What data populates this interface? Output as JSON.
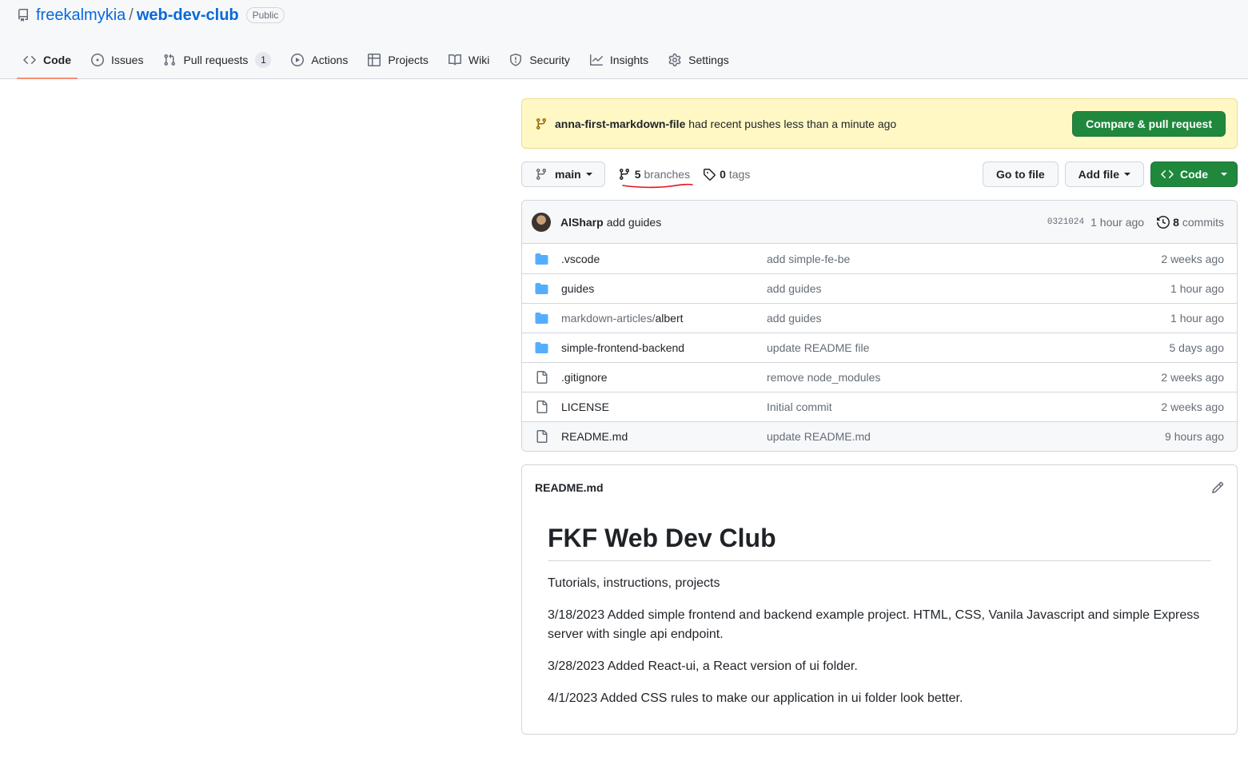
{
  "repo": {
    "owner": "freekalmykia",
    "separator": "/",
    "name": "web-dev-club",
    "visibility": "Public"
  },
  "tabs": [
    {
      "label": "Code",
      "icon": "code-icon",
      "active": true
    },
    {
      "label": "Issues",
      "icon": "issue-icon"
    },
    {
      "label": "Pull requests",
      "icon": "pull-request-icon",
      "count": "1"
    },
    {
      "label": "Actions",
      "icon": "play-icon"
    },
    {
      "label": "Projects",
      "icon": "table-icon"
    },
    {
      "label": "Wiki",
      "icon": "book-icon"
    },
    {
      "label": "Security",
      "icon": "shield-icon"
    },
    {
      "label": "Insights",
      "icon": "graph-icon"
    },
    {
      "label": "Settings",
      "icon": "gear-icon"
    }
  ],
  "banner": {
    "branch": "anna-first-markdown-file",
    "text": "had recent pushes less than a minute ago",
    "button": "Compare & pull request"
  },
  "toolbar": {
    "branch": "main",
    "branches_count": "5",
    "branches_label": "branches",
    "tags_count": "0",
    "tags_label": "tags",
    "go_to_file": "Go to file",
    "add_file": "Add file",
    "code": "Code"
  },
  "latest_commit": {
    "author": "AlSharp",
    "message": "add guides",
    "sha": "0321024",
    "time": "1 hour ago",
    "commits_count": "8",
    "commits_label": "commits"
  },
  "files": [
    {
      "type": "folder",
      "name": ".vscode",
      "prefix": "",
      "message": "add simple-fe-be",
      "time": "2 weeks ago"
    },
    {
      "type": "folder",
      "name": "guides",
      "prefix": "",
      "message": "add guides",
      "time": "1 hour ago"
    },
    {
      "type": "folder",
      "name": "albert",
      "prefix": "markdown-articles/",
      "message": "add guides",
      "time": "1 hour ago"
    },
    {
      "type": "folder",
      "name": "simple-frontend-backend",
      "prefix": "",
      "message": "update README file",
      "time": "5 days ago"
    },
    {
      "type": "file",
      "name": ".gitignore",
      "prefix": "",
      "message": "remove node_modules",
      "time": "2 weeks ago"
    },
    {
      "type": "file",
      "name": "LICENSE",
      "prefix": "",
      "message": "Initial commit",
      "time": "2 weeks ago"
    },
    {
      "type": "file",
      "name": "README.md",
      "prefix": "",
      "message": "update README.md",
      "time": "9 hours ago"
    }
  ],
  "readme": {
    "filename": "README.md",
    "title": "FKF Web Dev Club",
    "paragraphs": [
      "Tutorials, instructions, projects",
      "3/18/2023 Added simple frontend and backend example project. HTML, CSS, Vanila Javascript and simple Express server with single api endpoint.",
      "3/28/2023 Added React-ui, a React version of ui folder.",
      "4/1/2023 Added CSS rules to make our application in ui folder look better."
    ]
  },
  "colors": {
    "link": "#0969da",
    "primary_button": "#1f883d",
    "banner_bg": "#fff8c5",
    "folder": "#54aeff",
    "active_tab_underline": "#fd8c73",
    "annotation": "#e5121b"
  }
}
